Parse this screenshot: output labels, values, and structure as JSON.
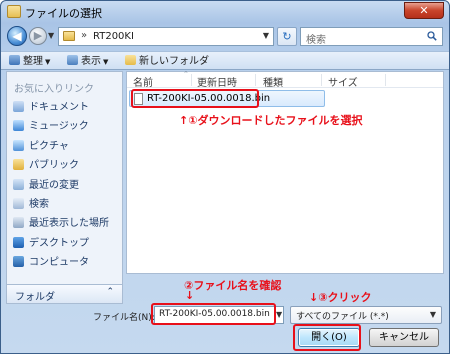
{
  "window": {
    "title": "ファイルの選択",
    "close_label": "✕"
  },
  "address": {
    "path": "RT200KI",
    "search_placeholder": "検索"
  },
  "toolbar": {
    "organize": "整理",
    "view": "表示",
    "new_folder": "新しいフォルダ"
  },
  "sidebar": {
    "favorites_heading": "お気に入りリンク",
    "items": [
      {
        "label": "ドキュメント",
        "icon": "documents-icon"
      },
      {
        "label": "ミュージック",
        "icon": "music-icon"
      },
      {
        "label": "ピクチャ",
        "icon": "pictures-icon"
      },
      {
        "label": "パブリック",
        "icon": "public-folder-icon"
      },
      {
        "label": "最近の変更",
        "icon": "recent-changes-icon"
      },
      {
        "label": "検索",
        "icon": "searches-icon"
      },
      {
        "label": "最近表示した場所",
        "icon": "recent-places-icon"
      },
      {
        "label": "デスクトップ",
        "icon": "desktop-icon"
      },
      {
        "label": "コンピュータ",
        "icon": "computer-icon"
      }
    ],
    "folder_bar_label": "フォルダ"
  },
  "file_list": {
    "columns": [
      "名前",
      "更新日時",
      "種類",
      "サイズ"
    ],
    "files": [
      {
        "name": "RT-200KI-05.00.0018.bin"
      }
    ]
  },
  "annotations": {
    "step1": "↑①ダウンロードしたファイルを選択",
    "step2": "②ファイル名を確認",
    "step2_arrow": "↓",
    "step3": "↓③クリック"
  },
  "footer": {
    "filename_label": "ファイル名(N):",
    "filename_value": "RT-200KI-05.00.0018.bin",
    "filetype_value": "すべてのファイル (*.*)",
    "open_label": "開く(O)",
    "cancel_label": "キャンセル"
  },
  "colors": {
    "annotation_red": "#e8101a",
    "accent_blue": "#3c7fb1"
  }
}
